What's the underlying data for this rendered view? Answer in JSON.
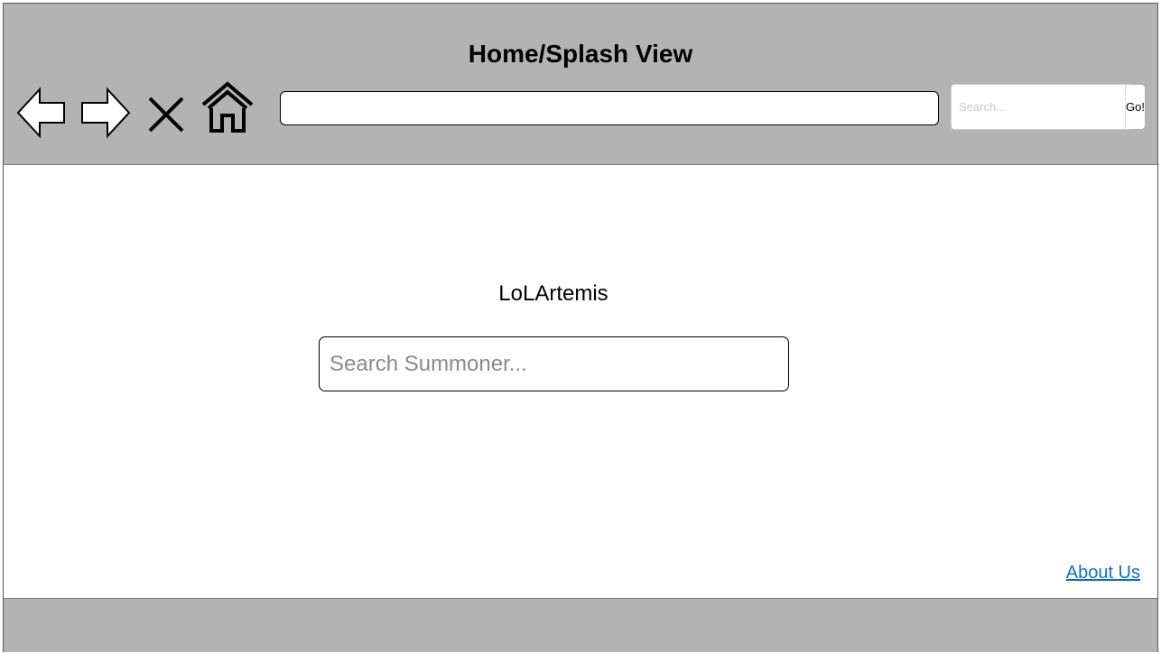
{
  "header": {
    "title": "Home/Splash View",
    "nav_icons": [
      "back-arrow-icon",
      "forward-arrow-icon",
      "close-icon",
      "home-icon"
    ],
    "url_value": "",
    "search": {
      "placeholder": "Search...",
      "button_label": "Go!"
    }
  },
  "main": {
    "brand": "LoLArtemis",
    "summoner_search": {
      "placeholder": "Search Summoner...",
      "value": ""
    },
    "about_link": "About Us"
  },
  "colors": {
    "bar_background": "#b3b3b3",
    "link": "#0b6fc7"
  }
}
